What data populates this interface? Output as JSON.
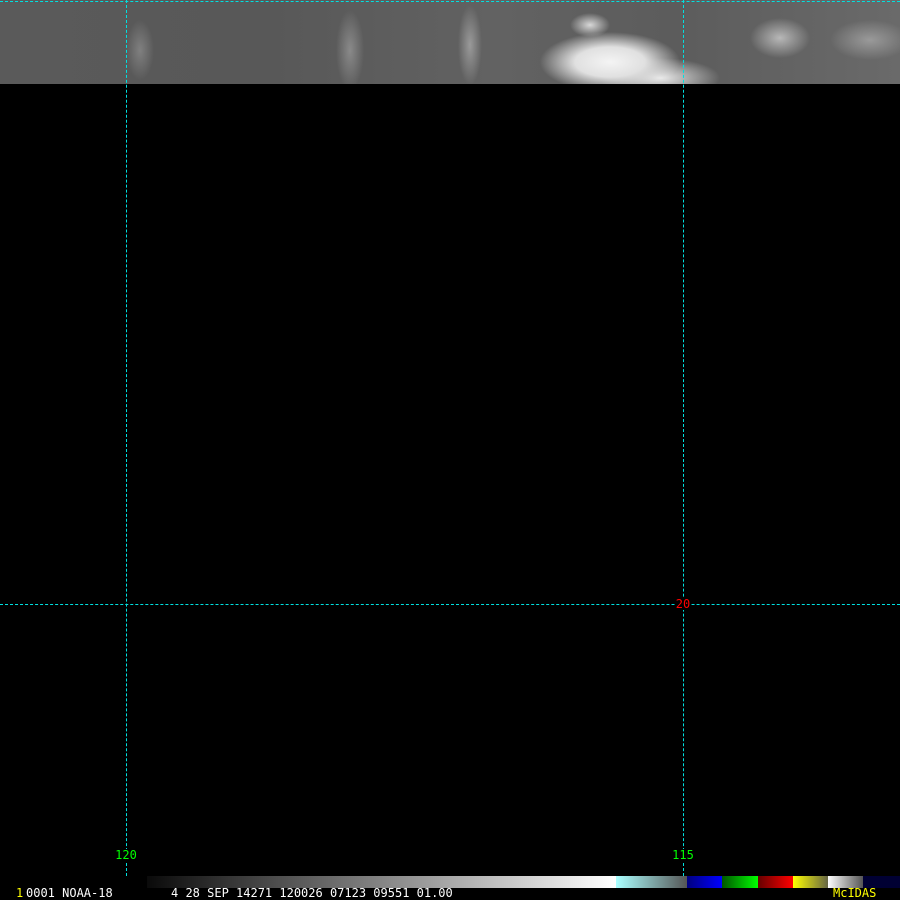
{
  "image": {
    "frame_number": "1",
    "info_left": "0001 NOAA-18",
    "info_right": "4 28 SEP 14271 120026 07123 09551 01.00",
    "brand": "McIDAS"
  },
  "grid": {
    "longitude_labels": [
      "120",
      "115"
    ],
    "latitude_labels": [
      "20"
    ],
    "line_color": "#00e0e0"
  },
  "colorbar": {
    "segments": [
      {
        "name": "grayscale",
        "from": "#0a0a0a",
        "to": "#ffffff"
      },
      {
        "name": "cyan-gray",
        "from": "#aaffff",
        "to": "#555555"
      },
      {
        "name": "blue",
        "from": "#000080",
        "to": "#0000ff"
      },
      {
        "name": "green",
        "from": "#005500",
        "to": "#00ff00"
      },
      {
        "name": "red",
        "from": "#660000",
        "to": "#ff0000"
      },
      {
        "name": "yellow",
        "from": "#ffff00",
        "to": "#666644"
      },
      {
        "name": "white-gray",
        "from": "#ffffff",
        "to": "#555555"
      },
      {
        "name": "navy",
        "from": "#000033",
        "to": "#000033"
      }
    ]
  }
}
